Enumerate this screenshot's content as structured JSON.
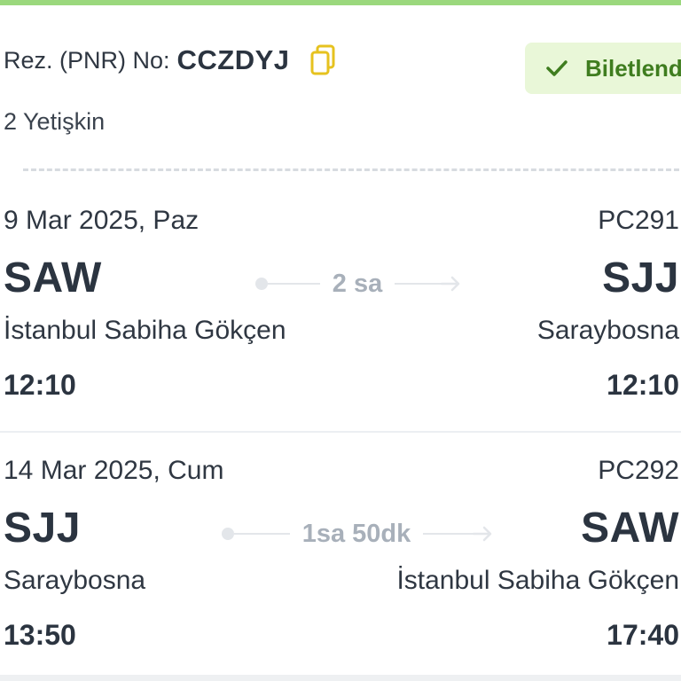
{
  "booking": {
    "pnr_label": "Rez. (PNR) No:",
    "pnr_value": "CCZDYJ",
    "status": "Biletlend",
    "passengers": "2 Yetişkin"
  },
  "legs": [
    {
      "date": "9 Mar 2025, Paz",
      "flight_no": "PC291",
      "from_code": "SAW",
      "to_code": "SJJ",
      "from_city": "İstanbul Sabiha Gökçen",
      "to_city": "Saraybosna",
      "dep_time": "12:10",
      "arr_time": "12:10",
      "duration": "2 sa"
    },
    {
      "date": "14 Mar 2025, Cum",
      "flight_no": "PC292",
      "from_code": "SJJ",
      "to_code": "SAW",
      "from_city": "Saraybosna",
      "to_city": "İstanbul Sabiha Gökçen",
      "dep_time": "13:50",
      "arr_time": "17:40",
      "duration": "1sa 50dk"
    }
  ],
  "colors": {
    "accent_green": "#9bd87d",
    "status_bg": "#e9f7d8",
    "status_text": "#3f7d1f",
    "copy_icon": "#e6c21f"
  },
  "icons": {
    "copy": "copy-icon",
    "status": "check-icon",
    "route_arrow": "arrow-right-icon"
  }
}
